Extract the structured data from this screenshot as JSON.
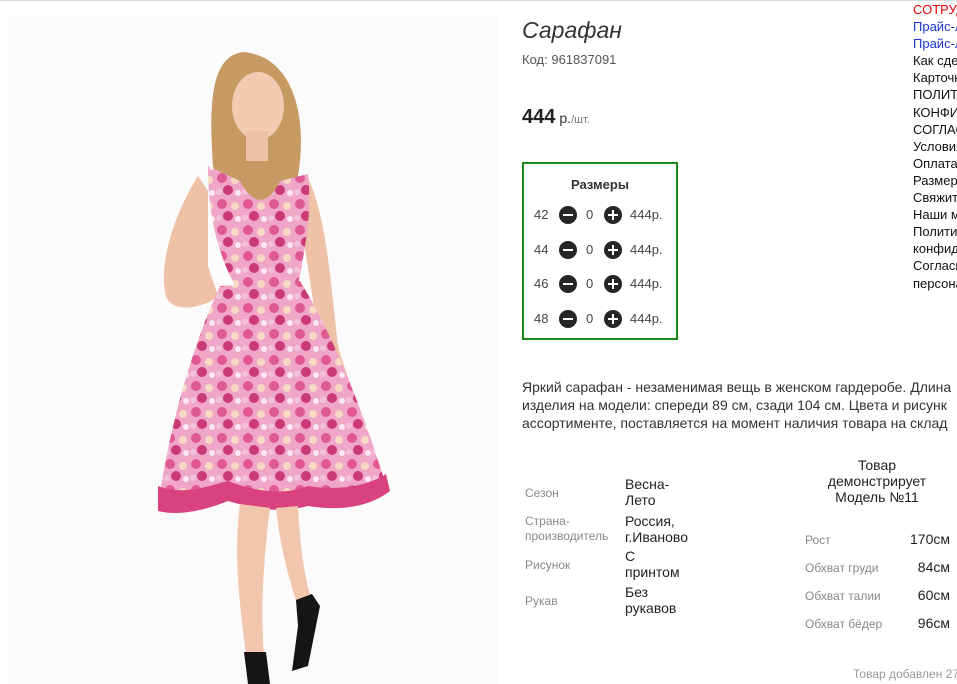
{
  "product": {
    "title": "Сарафан",
    "code_label": "Код:",
    "code": "961837091",
    "price": "444",
    "currency": "р.",
    "unit": "/шт."
  },
  "sizes": {
    "header": "Размеры",
    "rows": [
      {
        "size": "42",
        "qty": "0",
        "price": "444р."
      },
      {
        "size": "44",
        "qty": "0",
        "price": "444р."
      },
      {
        "size": "46",
        "qty": "0",
        "price": "444р."
      },
      {
        "size": "48",
        "qty": "0",
        "price": "444р."
      }
    ],
    "minus_icon": "minus-circle-icon",
    "plus_icon": "plus-circle-icon",
    "border_color": "#1a8a1a"
  },
  "description": [
    "Яркий сарафан - незаменимая вещь в женском гардеробе. Длина",
    "изделия на модели: спереди 89 см, сзади 104 см. Цвета и рисунк",
    "ассортименте, поставляется на момент наличия товара на склад"
  ],
  "properties": [
    {
      "key": "Сезон",
      "value": "Весна-Лето"
    },
    {
      "key": "Страна-производитель",
      "value": "Россия, г.Иваново"
    },
    {
      "key": "Рисунок",
      "value": "С принтом"
    },
    {
      "key": "Рукав",
      "value": "Без рукавов"
    }
  ],
  "model": {
    "title": "Товар демонстрирует Модель №11",
    "measurements": [
      {
        "key": "Рост",
        "value": "170см"
      },
      {
        "key": "Обхват груди",
        "value": "84см"
      },
      {
        "key": "Обхват талии",
        "value": "60см"
      },
      {
        "key": "Обхват бёдер",
        "value": "96см"
      }
    ]
  },
  "added_text": "Товар добавлен 27",
  "side_menu": [
    {
      "label": "СОТРУДНИЧЕСТВО",
      "color": "red"
    },
    {
      "label": "Прайс-лист",
      "color": "blue"
    },
    {
      "label": "Прайс-лист",
      "color": "blue"
    },
    {
      "label": "Как сделать заказ",
      "color": "default"
    },
    {
      "label": "Карточка",
      "color": "default"
    },
    {
      "label": "ПОЛИТИКА",
      "color": "default"
    },
    {
      "label": "КОНФИДЕНЦИАЛЬНОСТИ",
      "color": "default"
    },
    {
      "label": "СОГЛАСИЕ",
      "color": "default"
    },
    {
      "label": "Условия",
      "color": "default"
    },
    {
      "label": "Оплата",
      "color": "default"
    },
    {
      "label": "Размеры",
      "color": "default"
    },
    {
      "label": "Свяжитесь",
      "color": "default"
    },
    {
      "label": "Наши магазины",
      "color": "default"
    },
    {
      "label": "Политика",
      "color": "default"
    },
    {
      "label": "конфиденциальности",
      "color": "default"
    },
    {
      "label": "Согласие",
      "color": "default"
    },
    {
      "label": "персональных",
      "color": "default"
    }
  ],
  "image": {
    "subject": "product-photo-dress"
  }
}
